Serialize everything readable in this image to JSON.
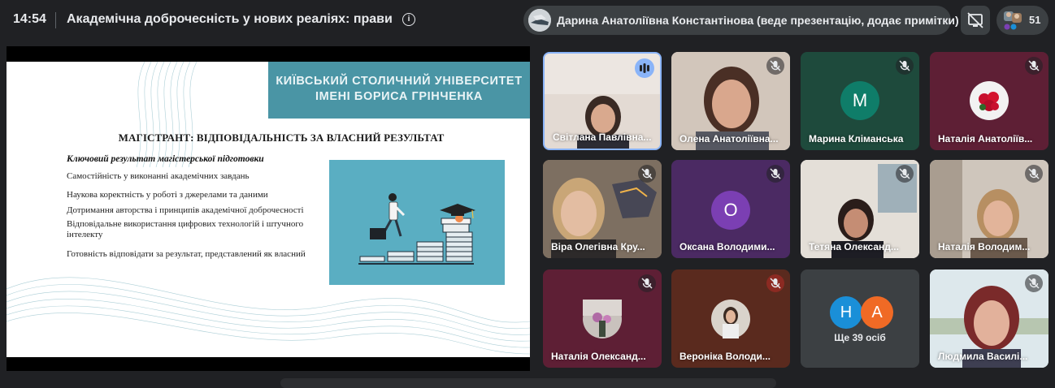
{
  "topbar": {
    "time": "14:54",
    "meeting_title": "Академічна доброчесність у нових реаліях: прави",
    "presenter_label": "Дарина Анатоліївна Константінова (веде презентацію, додає примітки)",
    "participants_count": "51"
  },
  "slide": {
    "banner_line1": "КИЇВСЬКИЙ СТОЛИЧНИЙ УНІВЕРСИТЕТ",
    "banner_line2": "ІМЕНІ БОРИСА ГРІНЧЕНКА",
    "title": "МАГІСТРАНТ: ВІДПОВІДАЛЬНІСТЬ ЗА ВЛАСНИЙ РЕЗУЛЬТАТ",
    "subtitle": "Ключовий результат магістерської підготовки",
    "bullets": [
      "Самостійність у виконанні академічних завдань",
      "Наукова коректність у роботі з джерелами та даними",
      "Дотримання авторства і принципів академічної доброчесності",
      "Відповідальне використання цифрових технологій і штучного інтелекту",
      "Готовність відповідати за результат, представлений як власний"
    ]
  },
  "tiles": [
    {
      "name": "Світлана Павлівна..."
    },
    {
      "name": "Олена Анатоліївна..."
    },
    {
      "name": "Марина Кліманська",
      "letter": "M"
    },
    {
      "name": "Наталія Анатоліїв..."
    },
    {
      "name": "Віра Олегівна Кру..."
    },
    {
      "name": "Оксана Володими...",
      "letter": "O"
    },
    {
      "name": "Тетяна Олександ..."
    },
    {
      "name": "Наталія Володим..."
    },
    {
      "name": "Наталія Олександ..."
    },
    {
      "name": "Вероніка Володи..."
    },
    {
      "name": "Ще 39 осіб",
      "letters": [
        "Н",
        "А"
      ]
    },
    {
      "name": "Людмила Василі..."
    }
  ],
  "colors": {
    "background": "#202124",
    "tile_green": "#1e4a3c",
    "tile_purple": "#4b2a63",
    "tile_maroon": "#5e1f35",
    "tile_brown": "#5a2a1e",
    "avatar_teal": "#0f7d69",
    "avatar_purple": "#7b3fb3",
    "avatar_blue": "#1a8fd8",
    "avatar_orange": "#f06a25",
    "banner_teal": "#4a95a5",
    "active_speaker": "#8ab4f8"
  },
  "icons": [
    "info-icon",
    "present-off-icon",
    "people-icon",
    "mic-off-icon",
    "speaking-icon"
  ]
}
